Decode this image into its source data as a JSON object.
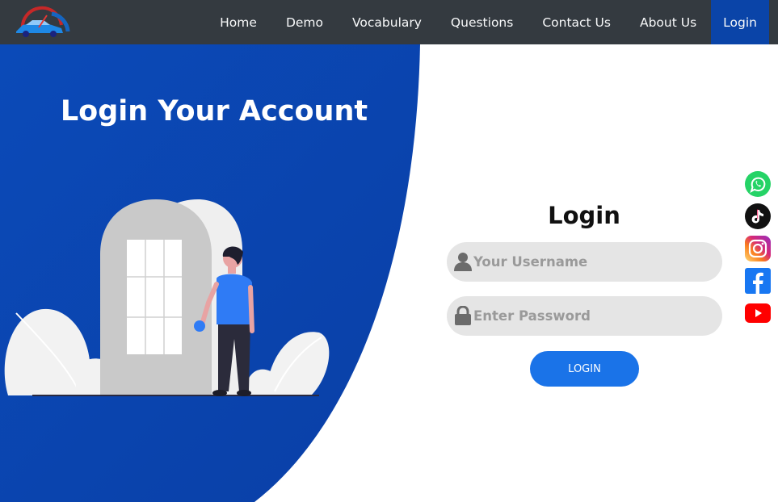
{
  "nav": {
    "items": [
      {
        "label": "Home"
      },
      {
        "label": "Demo"
      },
      {
        "label": "Vocabulary"
      },
      {
        "label": "Questions"
      },
      {
        "label": "Contact Us"
      },
      {
        "label": "About Us"
      },
      {
        "label": "Login",
        "active": true
      }
    ]
  },
  "hero": {
    "title": "Login Your Account"
  },
  "form": {
    "title": "Login",
    "username_placeholder": "Your Username",
    "password_placeholder": "Enter Password",
    "submit_label": "LOGIN"
  },
  "social": [
    {
      "icon": "whatsapp-icon"
    },
    {
      "icon": "tiktok-icon"
    },
    {
      "icon": "instagram-icon"
    },
    {
      "icon": "facebook-icon"
    },
    {
      "icon": "youtube-icon"
    }
  ],
  "colors": {
    "navbar": "#343a40",
    "nav_active": "#0a44a8",
    "hero_blue": "#0b4ab5",
    "button": "#1a73e8",
    "field_bg": "#e5e5e5"
  }
}
